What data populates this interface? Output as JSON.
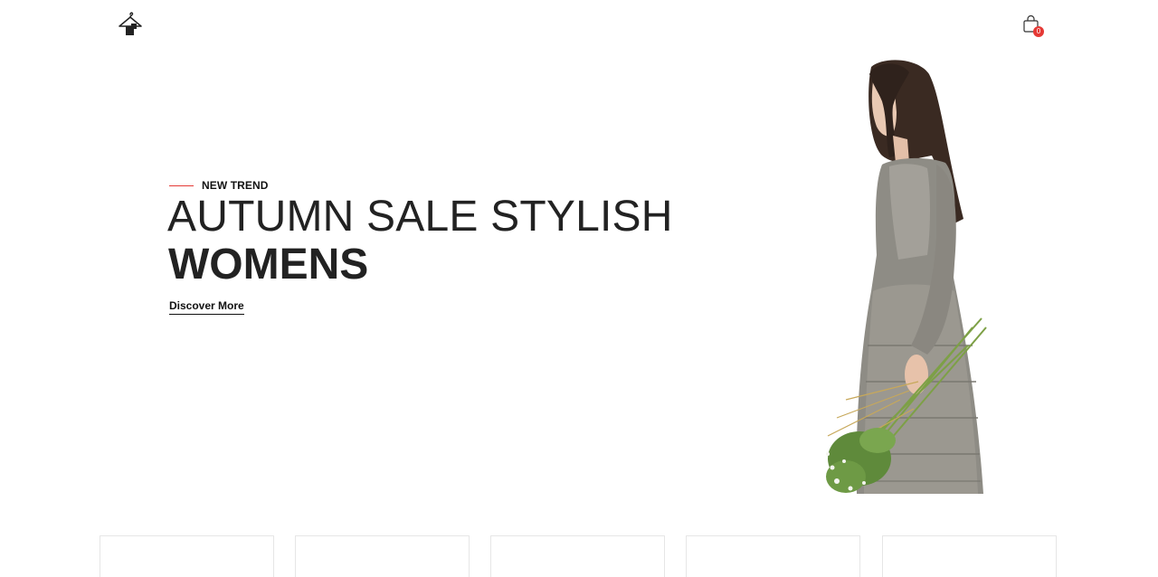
{
  "header": {
    "logo_icon": "hanger-logo-icon",
    "cart_icon": "shopping-bag-icon",
    "cart_count": "0",
    "accent_color": "#e53935"
  },
  "hero": {
    "eyebrow": "NEW TREND",
    "title_line1": "AUTUMN SALE STYLISH",
    "title_line2": "WOMENS",
    "cta_label": "Discover More"
  },
  "cards": [
    {
      "id": "card-1"
    },
    {
      "id": "card-2"
    },
    {
      "id": "card-3"
    },
    {
      "id": "card-4"
    },
    {
      "id": "card-5"
    }
  ]
}
